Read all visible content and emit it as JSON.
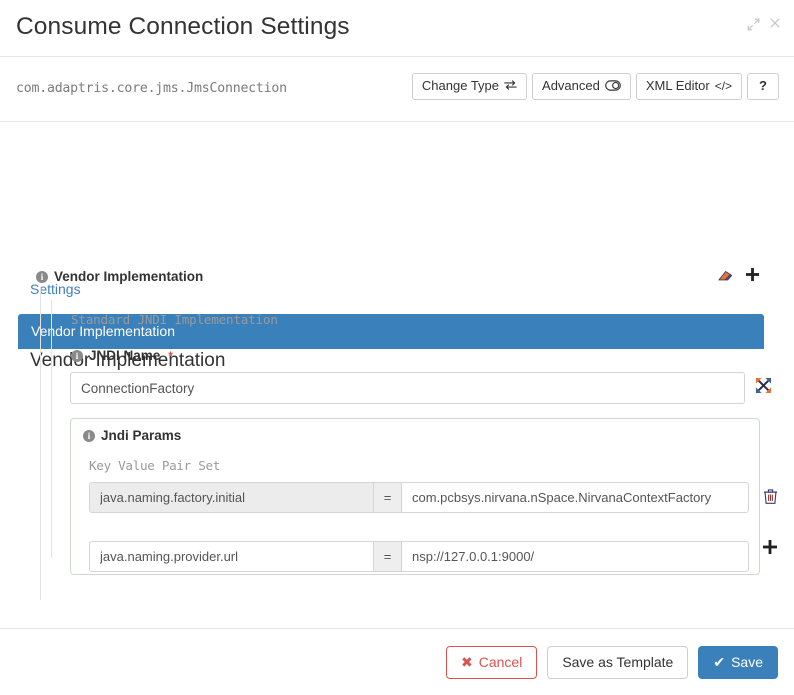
{
  "header": {
    "title": "Consume Connection Settings",
    "expand_icon": "expand-arrows-icon",
    "close_icon": "close-icon"
  },
  "type_row": {
    "class_name": "com.adaptris.core.jms.JmsConnection",
    "buttons": [
      {
        "label": "Change Type",
        "icon": "⇄",
        "name": "change-type-button"
      },
      {
        "label": "Advanced",
        "icon": "ⓧ",
        "name": "advanced-toggle-button"
      },
      {
        "label": "XML Editor",
        "icon": "</>",
        "name": "xml-editor-button"
      },
      {
        "label": "?",
        "icon": "",
        "name": "help-button"
      }
    ]
  },
  "tabs": {
    "settings_label": "Settings"
  },
  "accordion": {
    "bar_label": "Vendor Implementation",
    "section_heading": "Vendor Implementation"
  },
  "group": {
    "title": "Vendor Implementation",
    "info_icon": "info-icon",
    "erase_icon": "eraser-icon",
    "add_icon": "➕"
  },
  "vendor": {
    "description": "Standard JNDI Implementation",
    "jndi_name_label": "JNDI Name",
    "required_marker": "*",
    "jndi_name_value": "ConnectionFactory",
    "jndi_name_placeholder": "",
    "expand_icon": "expand-field-icon"
  },
  "jndi_params": {
    "title": "Jndi Params",
    "kvp_label": "Key Value Pair Set",
    "equals_symbol": "=",
    "rows": [
      {
        "key": "java.naming.factory.initial",
        "value": "com.pcbsys.nirvana.nSpace.NirvanaContextFactory",
        "action": "delete-row",
        "action_icon": "trash-icon"
      },
      {
        "key": "java.naming.provider.url",
        "value": "nsp://127.0.0.1:9000/",
        "action": "add-row",
        "action_icon": "plus-icon"
      }
    ]
  },
  "footer": {
    "cancel_label": "Cancel",
    "cancel_icon": "✖",
    "save_as_template_label": "Save as Template",
    "save_label": "Save",
    "save_icon": "✔"
  },
  "colors": {
    "accent_blue": "#3a80ba",
    "danger_red": "#d9534f",
    "link_blue": "#3f7fbf",
    "box_border_green": "#cdd9cd"
  }
}
